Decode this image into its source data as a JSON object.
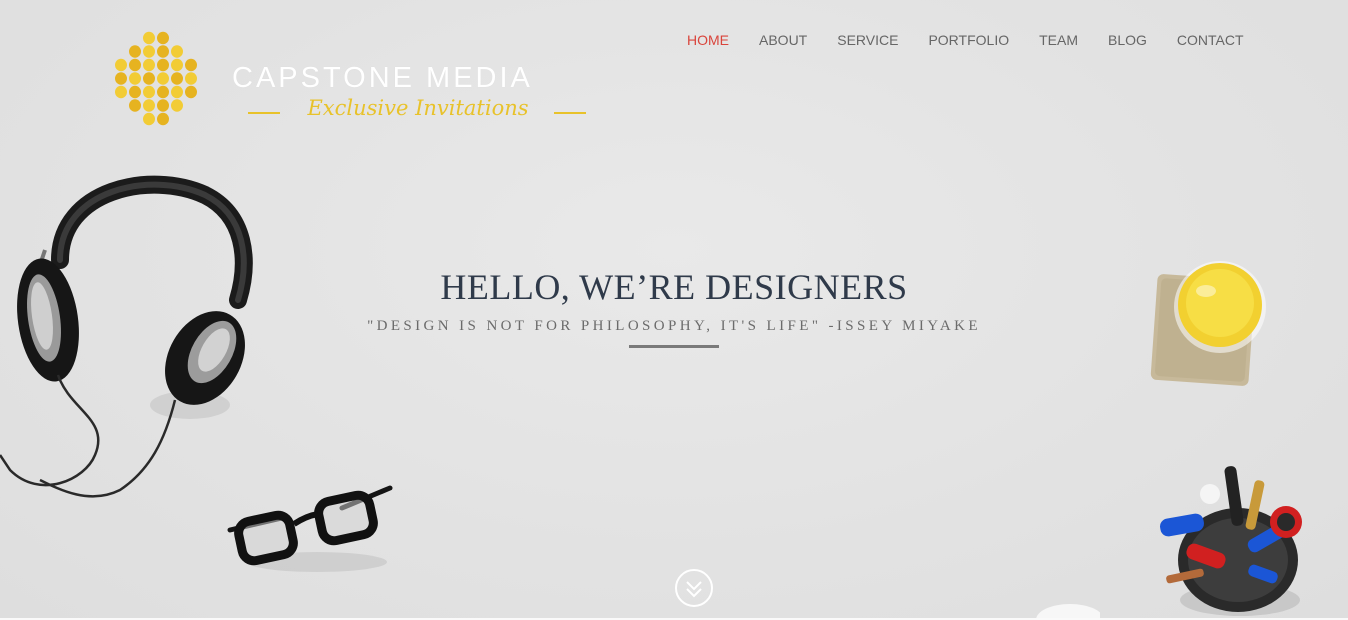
{
  "logo": {
    "title": "CAPSTONE MEDIA",
    "tagline": "Exclusive Invitations",
    "brand_color": "#e8c22a"
  },
  "nav": {
    "items": [
      {
        "label": "HOME",
        "active": true
      },
      {
        "label": "ABOUT",
        "active": false
      },
      {
        "label": "SERVICE",
        "active": false
      },
      {
        "label": "PORTFOLIO",
        "active": false
      },
      {
        "label": "TEAM",
        "active": false
      },
      {
        "label": "BLOG",
        "active": false
      },
      {
        "label": "CONTACT",
        "active": false
      }
    ],
    "active_color": "#d9443b"
  },
  "hero": {
    "headline": "HELLO, WE’RE DESIGNERS",
    "quote": "\"DESIGN IS NOT FOR PHILOSOPHY, IT'S LIFE\" -ISSEY MIYAKE",
    "scroll_icon": "double-chevron-down-icon"
  },
  "decorations": [
    "headphones",
    "eyeglasses",
    "orange-juice-glass",
    "pen-holder"
  ]
}
